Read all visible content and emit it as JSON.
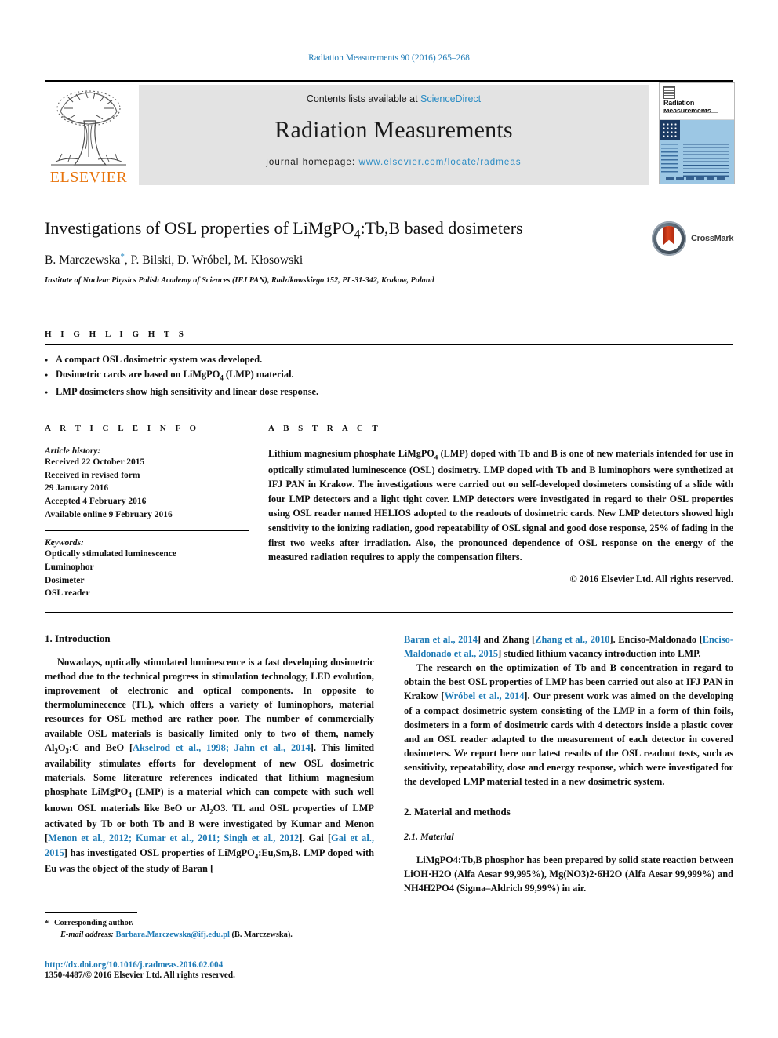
{
  "running_head": "Radiation Measurements 90 (2016) 265–268",
  "masthead": {
    "contents_prefix": "Contents lists available at ",
    "sciencedirect": "ScienceDirect",
    "journal_name": "Radiation Measurements",
    "homepage_prefix": "journal homepage: ",
    "homepage_url": "www.elsevier.com/locate/radmeas",
    "publisher": "ELSEVIER",
    "cover_title": "Radiation Measurements"
  },
  "article": {
    "title": "Investigations of OSL properties of LiMgPO4:Tb,B based dosimeters",
    "title_pre": "Investigations of OSL properties of LiMgPO",
    "title_sub": "4",
    "title_post": ":Tb,B based dosimeters",
    "authors": "B. Marczewska, P. Bilski, D. Wróbel, M. Kłosowski",
    "authors_first": "B. Marczewska",
    "authors_rest": ", P. Bilski, D. Wróbel, M. Kłosowski",
    "affiliation": "Institute of Nuclear Physics Polish Academy of Sciences (IFJ PAN), Radzikowskiego 152, PL-31-342, Krakow, Poland",
    "crossmark_label": "CrossMark"
  },
  "highlights": {
    "heading": "H I G H L I G H T S",
    "items": [
      "A compact OSL dosimetric system was developed.",
      "Dosimetric cards are based on LiMgPO4 (LMP) material.",
      "LMP dosimeters show high sensitivity and linear dose response."
    ]
  },
  "article_info": {
    "heading": "A R T I C L E   I N F O",
    "history_label": "Article history:",
    "history": [
      "Received 22 October 2015",
      "Received in revised form",
      "29 January 2016",
      "Accepted 4 February 2016",
      "Available online 9 February 2016"
    ],
    "keywords_label": "Keywords:",
    "keywords": [
      "Optically stimulated luminescence",
      "Luminophor",
      "Dosimeter",
      "OSL reader"
    ]
  },
  "abstract": {
    "heading": "A B S T R A C T",
    "text": "Lithium magnesium phosphate LiMgPO4 (LMP) doped with Tb and B is one of new materials intended for use in optically stimulated luminescence (OSL) dosimetry. LMP doped with Tb and B luminophors were synthetized at IFJ PAN in Krakow. The investigations were carried out on self-developed dosimeters consisting of a slide with four LMP detectors and a light tight cover. LMP detectors were investigated in regard to their OSL properties using OSL reader named HELIOS adopted to the readouts of dosimetric cards. New LMP detectors showed high sensitivity to the ionizing radiation, good repeatability of OSL signal and good dose response, 25% of fading in the first two weeks after irradiation. Also, the pronounced dependence of OSL response on the energy of the measured radiation requires to apply the compensation filters.",
    "copyright": "© 2016 Elsevier Ltd. All rights reserved."
  },
  "body": {
    "intro_heading": "1. Introduction",
    "intro_p1_a": "Nowadays, optically stimulated luminescence is a fast developing dosimetric method due to the technical progress in stimulation technology, LED evolution, improvement of electronic and optical components. In opposite to thermoluminecence (TL), which offers a variety of luminophors, material resources for OSL method are rather poor. The number of commercially available OSL materials is basically limited only to two of them, namely Al2O3:C and BeO [",
    "cite1": "Akselrod et al., 1998; Jahn et al., 2014",
    "intro_p1_b": "]. This limited availability stimulates efforts for development of new OSL dosimetric materials. Some literature references indicated that lithium magnesium phosphate LiMgPO4 (LMP) is a material which can compete with such well known OSL materials like BeO or Al2O3. TL and OSL properties of LMP activated by Tb or both Tb and B were investigated by Kumar and Menon [",
    "cite2": "Menon et al., 2012; Kumar et al., 2011; Singh et al., 2012",
    "intro_p1_c": "]. Gai [",
    "cite3": "Gai et al., 2015",
    "intro_p1_d": "] has investigated OSL properties of LiMgPO4:Eu,Sm,B. LMP doped with Eu was the object of the study of Baran [",
    "cite4": "Baran et al., 2014",
    "intro_p1_e": "] and Zhang [",
    "cite5": "Zhang et al., 2010",
    "intro_p1_f": "]. Enciso-Maldonado [",
    "cite6": "Enciso-Maldonado et al., 2015",
    "intro_p1_g": "] studied lithium vacancy introduction into LMP.",
    "intro_p2_a": "The research on the optimization of Tb and B concentration in regard to obtain the best OSL properties of LMP has been carried out also at IFJ PAN in Krakow [",
    "cite7": "Wróbel et al., 2014",
    "intro_p2_b": "]. Our present work was aimed on the developing of a compact dosimetric system consisting of the LMP in a form of thin foils, dosimeters in a form of dosimetric cards with 4 detectors inside a plastic cover and an OSL reader adapted to the measurement of each detector in covered dosimeters. We report here our latest results of the OSL readout tests, such as sensitivity, repeatability, dose and energy response, which were investigated for the developed LMP material tested in a new dosimetric system.",
    "methods_heading": "2. Material and methods",
    "material_heading": "2.1. Material",
    "material_p1": "LiMgPO4:Tb,B phosphor has been prepared by solid state reaction between LiOH·H2O (Alfa Aesar 99,995%), Mg(NO3)2·6H2O (Alfa Aesar 99,999%) and NH4H2PO4 (Sigma–Aldrich 99,99%) in air."
  },
  "footer": {
    "corresponding": "Corresponding author.",
    "email_label": "E-mail address:",
    "email": "Barbara.Marczewska@ifj.edu.pl",
    "email_suffix": "(B. Marczewska).",
    "doi": "http://dx.doi.org/10.1016/j.radmeas.2016.02.004",
    "issn": "1350-4487/© 2016 Elsevier Ltd. All rights reserved."
  },
  "colors": {
    "link": "#1f7bb6",
    "sciencedirect": "#2b8cc4",
    "elsevier_orange": "#E8740C"
  }
}
